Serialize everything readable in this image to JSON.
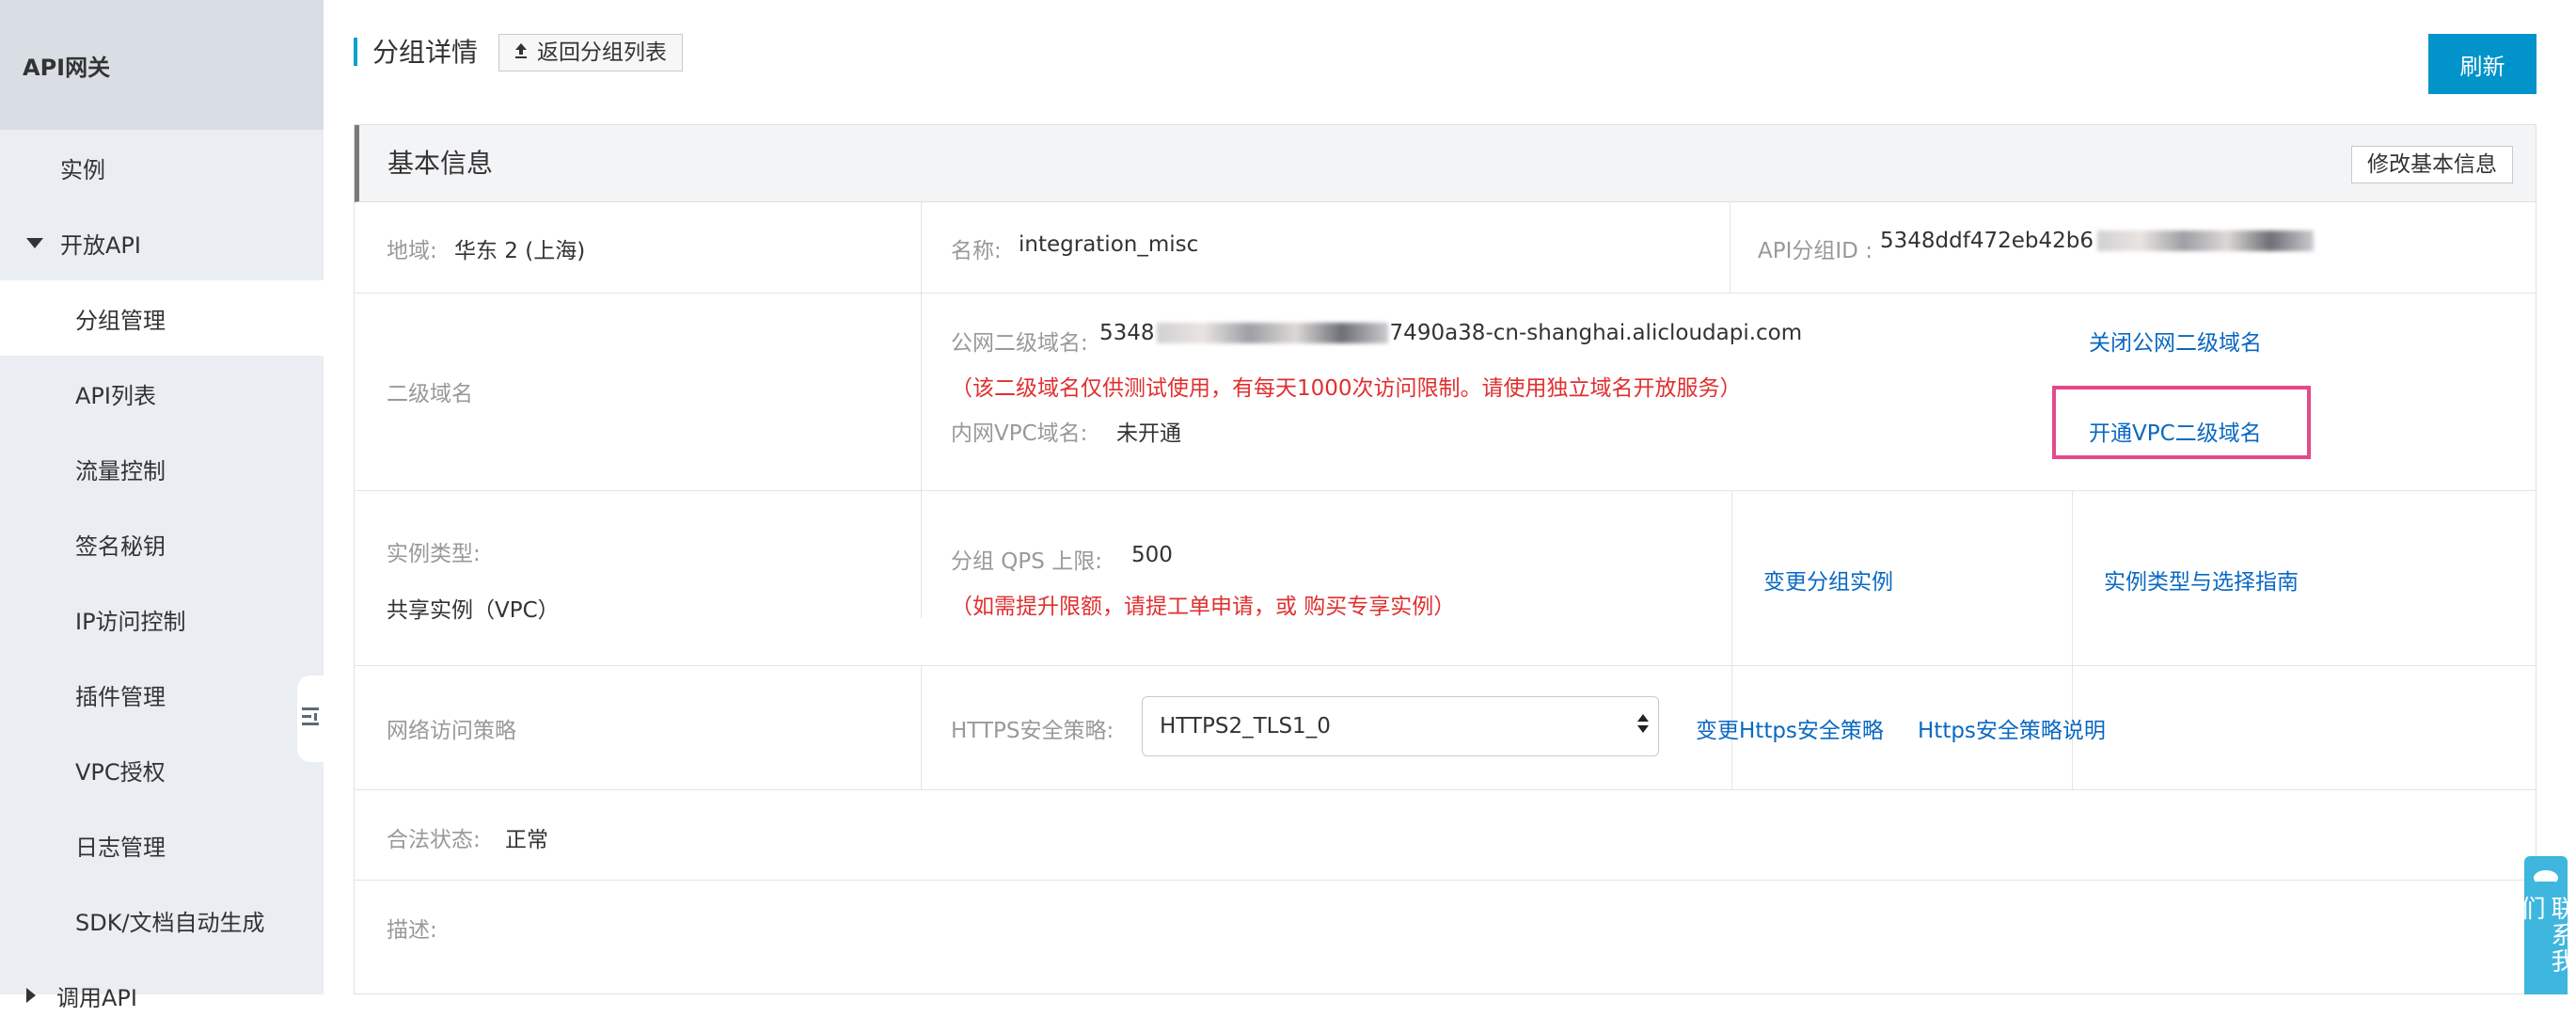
{
  "sidebar": {
    "title": "API网关",
    "items": [
      {
        "label": "实例"
      },
      {
        "label": "开放API"
      },
      {
        "label": "分组管理"
      },
      {
        "label": "API列表"
      },
      {
        "label": "流量控制"
      },
      {
        "label": "签名秘钥"
      },
      {
        "label": "IP访问控制"
      },
      {
        "label": "插件管理"
      },
      {
        "label": "VPC授权"
      },
      {
        "label": "日志管理"
      },
      {
        "label": "SDK/文档自动生成"
      },
      {
        "label": "调用API"
      }
    ]
  },
  "header": {
    "title": "分组详情",
    "back_label": "返回分组列表",
    "refresh_label": "刷新"
  },
  "basic_info": {
    "title": "基本信息",
    "edit_label": "修改基本信息",
    "region_label": "地域:",
    "region_value": "华东 2 (上海)",
    "name_label": "名称:",
    "name_value": "integration_misc",
    "group_id_label": "API分组ID :",
    "group_id_value": "5348ddf472eb42b6"
  },
  "subdomain": {
    "section_label": "二级域名",
    "public_label": "公网二级域名:",
    "public_prefix": "5348",
    "public_suffix": "7490a38-cn-shanghai.alicloudapi.com",
    "notice": "（该二级域名仅供测试使用，有每天1000次访问限制。请使用独立域名开放服务）",
    "vpc_label": "内网VPC域名:",
    "vpc_value": "未开通",
    "close_public_link": "关闭公网二级域名",
    "open_vpc_link": "开通VPC二级域名"
  },
  "instance": {
    "type_label": "实例类型:",
    "type_value": "共享实例（VPC）",
    "qps_label": "分组 QPS 上限:",
    "qps_value": "500",
    "qps_notice": "（如需提升限额，请提工单申请，或 购买专享实例）",
    "change_instance_link": "变更分组实例",
    "guide_link": "实例类型与选择指南"
  },
  "network": {
    "section_label": "网络访问策略",
    "https_label": "HTTPS安全策略:",
    "https_selected": "HTTPS2_TLS1_0",
    "change_https_link": "变更Https安全策略",
    "https_doc_link": "Https安全策略说明"
  },
  "status": {
    "label": "合法状态:",
    "value": "正常"
  },
  "description": {
    "label": "描述:"
  },
  "contact": {
    "label": "联系我们"
  },
  "colors": {
    "accent": "#0193c9",
    "link": "#0a68c2",
    "warning": "#e02f2f",
    "highlight": "#e4498c",
    "sidebar_bg": "#eaedf1"
  }
}
